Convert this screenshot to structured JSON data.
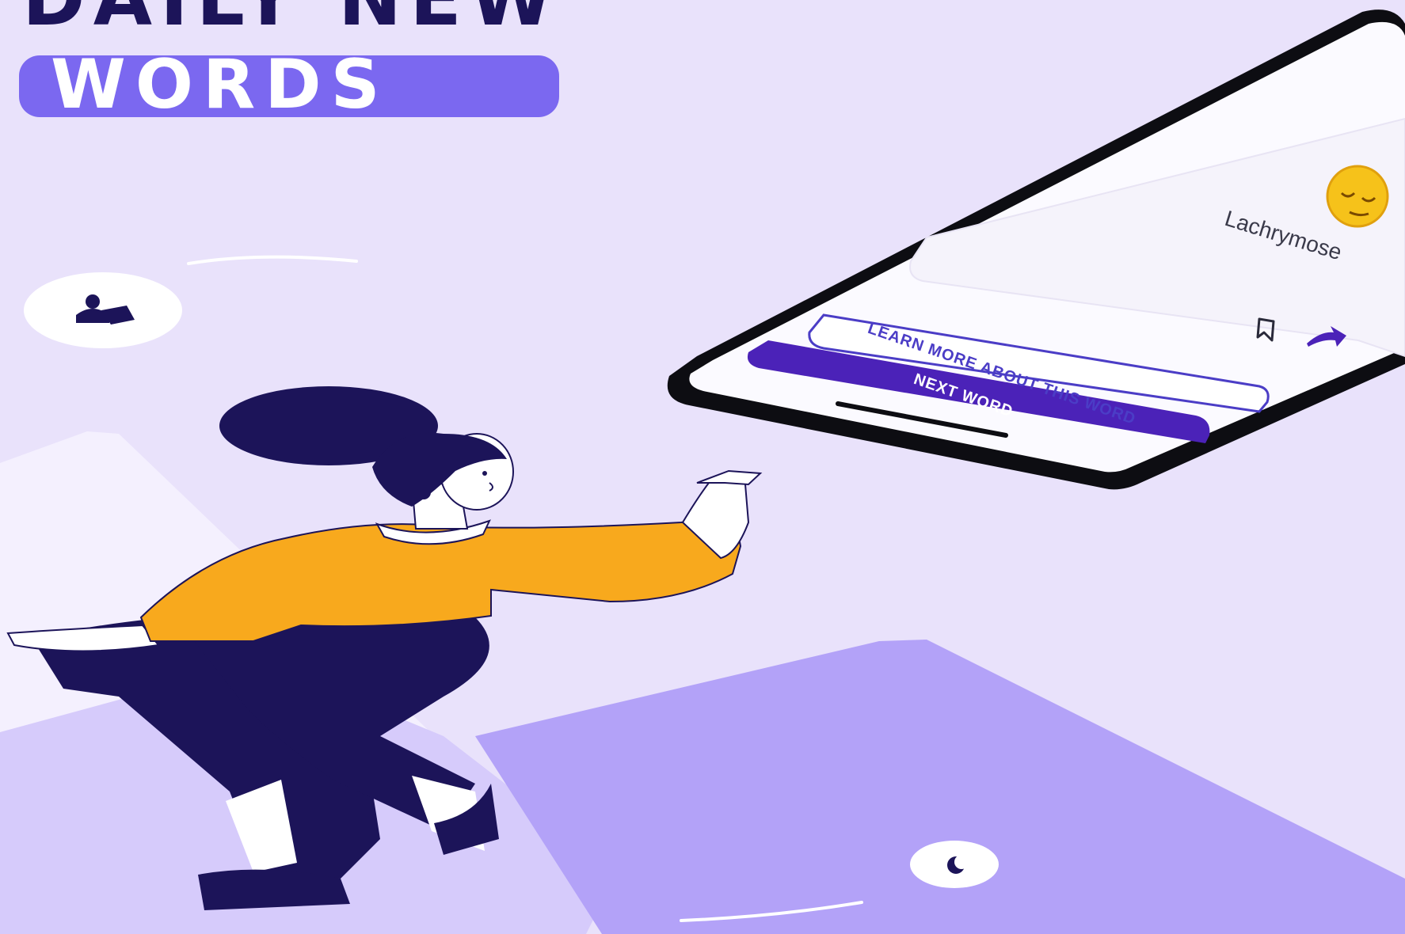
{
  "heading": {
    "line1": "DAILY NEW",
    "line2": "WORDS"
  },
  "phone_screen": {
    "word": "Lachrymose",
    "emoji": "pensive-face",
    "learn_more_button": "LEARN MORE ABOUT THIS WORD",
    "next_word_button": "NEXT WORD",
    "icons": [
      "bookmark-icon",
      "share-icon"
    ]
  },
  "decorations": {
    "badge_icons": [
      "reader-icon",
      "moon-icon"
    ]
  },
  "colors": {
    "background": "#e9e2fb",
    "accent_purple": "#7b68f0",
    "deep_purple": "#4b22b8",
    "navy": "#1c1459",
    "shirt_orange": "#f8a91d",
    "light_tile": "#f4f0fe",
    "mid_tile": "#d6cbfb",
    "floor": "#b3a2f8"
  }
}
